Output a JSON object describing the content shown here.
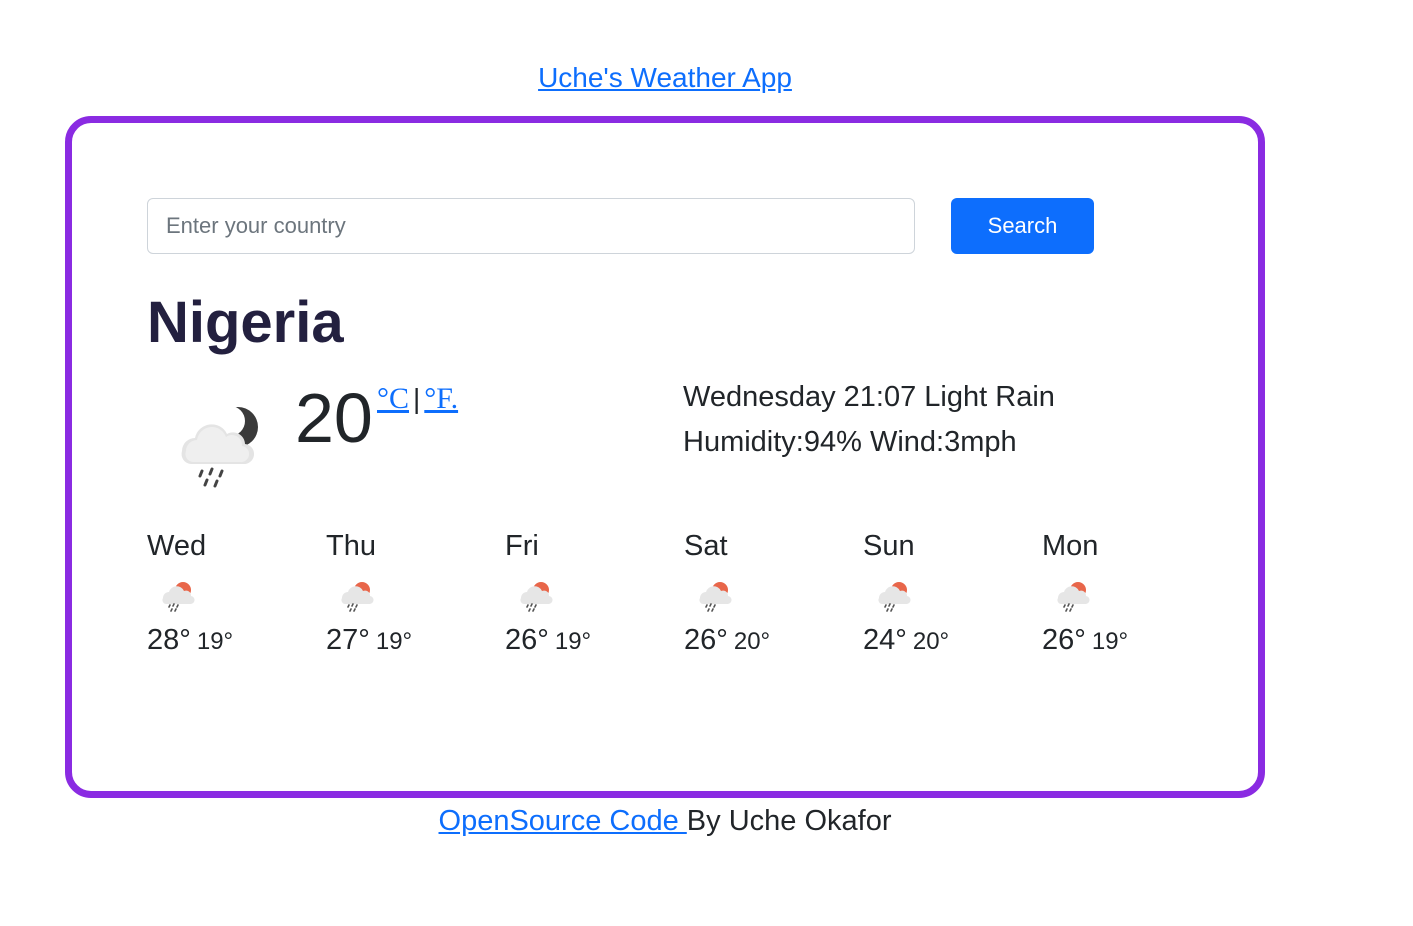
{
  "header": {
    "title": "Uche's Weather App"
  },
  "search": {
    "placeholder": "Enter your country",
    "value": "",
    "button_label": "Search"
  },
  "current": {
    "city": "Nigeria",
    "temperature": "20",
    "unit_celsius": "°C",
    "unit_separator": "|",
    "unit_fahrenheit": "°F.",
    "icon": "rain-cloud-night-icon",
    "day_time_description": "Wednesday 21:07 Light Rain",
    "humidity_wind": "Humidity:94% Wind:3mph"
  },
  "forecast": [
    {
      "day": "Wed",
      "max": "28°",
      "min": "19°",
      "icon": "rain-cloud-sun-icon"
    },
    {
      "day": "Thu",
      "max": "27°",
      "min": "19°",
      "icon": "rain-cloud-sun-icon"
    },
    {
      "day": "Fri",
      "max": "26°",
      "min": "19°",
      "icon": "rain-cloud-sun-icon"
    },
    {
      "day": "Sat",
      "max": "26°",
      "min": "20°",
      "icon": "rain-cloud-sun-icon"
    },
    {
      "day": "Sun",
      "max": "24°",
      "min": "20°",
      "icon": "rain-cloud-sun-icon"
    },
    {
      "day": "Mon",
      "max": "26°",
      "min": "19°",
      "icon": "rain-cloud-sun-icon"
    }
  ],
  "footer": {
    "link_text": "OpenSource Code ",
    "credit": "By Uche Okafor"
  },
  "colors": {
    "card_border": "#8a2be2",
    "button": "#0d6efd",
    "link": "#0d6efd",
    "city_text": "#23203f"
  }
}
